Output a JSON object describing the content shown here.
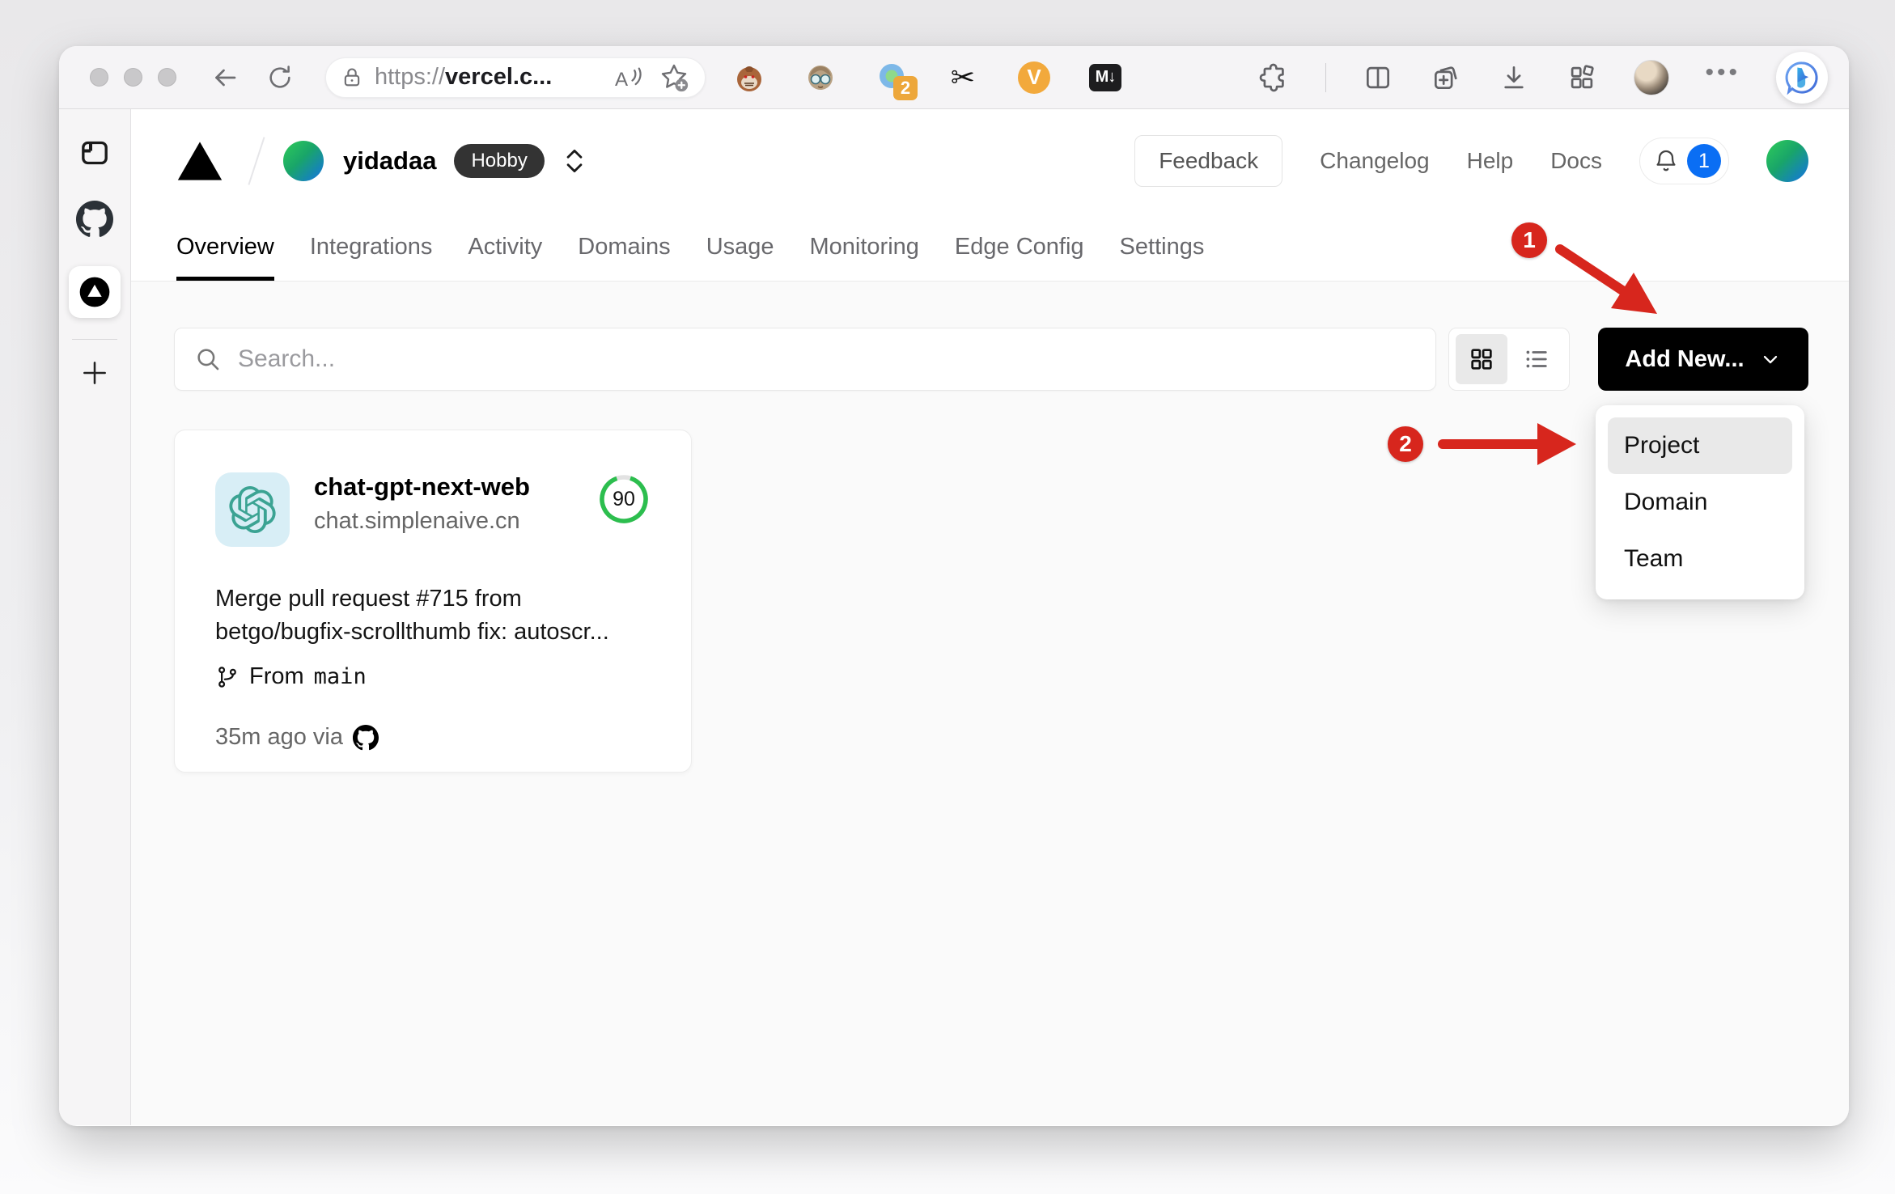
{
  "browser": {
    "url": {
      "scheme": "https://",
      "host": "vercel.c..."
    },
    "extensions": [
      {
        "name": "tampermonkey"
      },
      {
        "name": "avatar-extension"
      },
      {
        "name": "session-extension",
        "badge": "2"
      },
      {
        "name": "clipper-extension",
        "glyph": "✂"
      },
      {
        "name": "v-extension",
        "label": "V"
      },
      {
        "name": "markdownload-extension",
        "label": "M↓"
      }
    ],
    "more_glyph": "•••"
  },
  "sidebar": {
    "tabs": [
      "browser-window",
      "github",
      "vercel"
    ],
    "new_tab": "+"
  },
  "header": {
    "team_name": "yidadaa",
    "plan_badge": "Hobby",
    "feedback_label": "Feedback",
    "links": {
      "changelog": "Changelog",
      "help": "Help",
      "docs": "Docs"
    },
    "notification_count": "1"
  },
  "tabs": [
    {
      "label": "Overview",
      "active": true
    },
    {
      "label": "Integrations",
      "active": false
    },
    {
      "label": "Activity",
      "active": false
    },
    {
      "label": "Domains",
      "active": false
    },
    {
      "label": "Usage",
      "active": false
    },
    {
      "label": "Monitoring",
      "active": false
    },
    {
      "label": "Edge Config",
      "active": false
    },
    {
      "label": "Settings",
      "active": false
    }
  ],
  "toolbar": {
    "search_placeholder": "Search...",
    "add_new_label": "Add New..."
  },
  "dropdown": {
    "items": [
      "Project",
      "Domain",
      "Team"
    ],
    "selected": "Project"
  },
  "project_card": {
    "name": "chat-gpt-next-web",
    "domain": "chat.simplenaive.cn",
    "score": "90",
    "commit_line1": "Merge pull request #715 from",
    "commit_line2": "betgo/bugfix-scrollthumb fix: autoscr...",
    "branch_prefix": "From",
    "branch_name": "main",
    "deployed_meta": "35m ago via"
  },
  "annotations": {
    "step1": "1",
    "step2": "2"
  },
  "colors": {
    "accent_black": "#000000",
    "annotation_red": "#d7261d",
    "notification_blue": "#0a6ef4",
    "score_green": "#2cbe4e",
    "avatar_gradient": [
      "#2fcc59",
      "#1472e6"
    ],
    "openai_teal": "#3ba393"
  }
}
